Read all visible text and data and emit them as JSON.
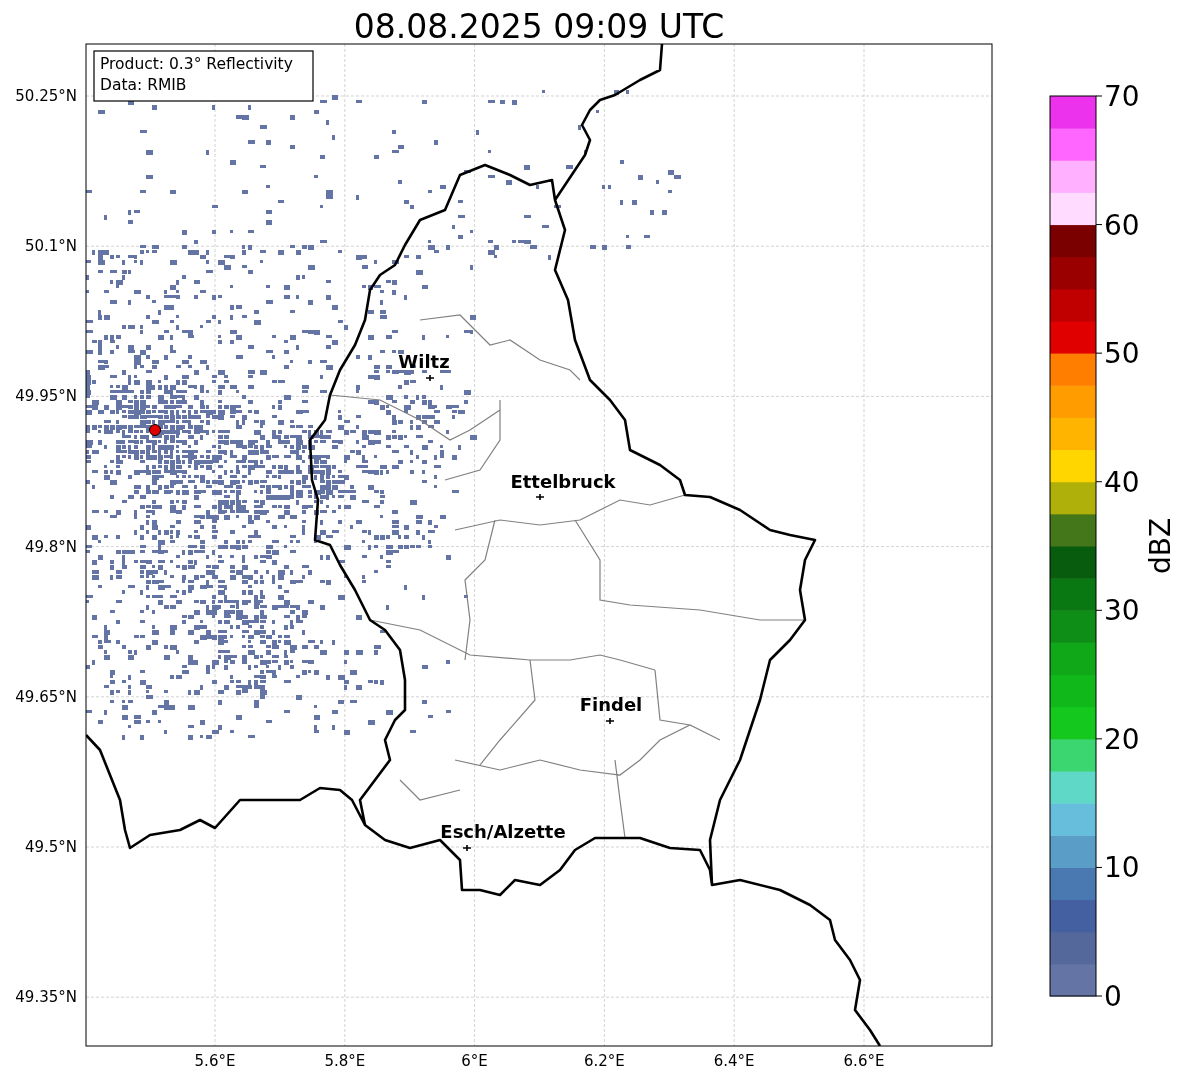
{
  "title": "08.08.2025 09:09 UTC",
  "info_box": [
    "Product: 0.3° Reflectivity",
    "Data: RMIB"
  ],
  "lat_ticks": [
    "50.25°N",
    "50.1°N",
    "49.95°N",
    "49.8°N",
    "49.65°N",
    "49.5°N",
    "49.35°N"
  ],
  "lon_ticks": [
    "5.6°E",
    "5.8°E",
    "6°E",
    "6.2°E",
    "6.4°E",
    "6.6°E"
  ],
  "cities": [
    {
      "name": "Wiltz"
    },
    {
      "name": "Ettelbruck"
    },
    {
      "name": "Findel"
    },
    {
      "name": "Esch/Alzette"
    }
  ],
  "colorbar": {
    "label": "dBZ",
    "ticks": [
      "70",
      "60",
      "50",
      "40",
      "30",
      "20",
      "10",
      "0"
    ],
    "segments": [
      {
        "color": "#6474a4"
      },
      {
        "color": "#54689c"
      },
      {
        "color": "#4460a0"
      },
      {
        "color": "#4a78b0"
      },
      {
        "color": "#5a9ec8"
      },
      {
        "color": "#66bedc"
      },
      {
        "color": "#60d8c8"
      },
      {
        "color": "#3cd670"
      },
      {
        "color": "#14c81e"
      },
      {
        "color": "#10b81a"
      },
      {
        "color": "#10a818"
      },
      {
        "color": "#0e8e16"
      },
      {
        "color": "#0a7812"
      },
      {
        "color": "#085c0e"
      },
      {
        "color": "#44761a"
      },
      {
        "color": "#b0b00a"
      },
      {
        "color": "#ffd600"
      },
      {
        "color": "#ffb400"
      },
      {
        "color": "#ff9c00"
      },
      {
        "color": "#ff7e00"
      },
      {
        "color": "#e00000"
      },
      {
        "color": "#c00000"
      },
      {
        "color": "#9a0000"
      },
      {
        "color": "#7a0000"
      },
      {
        "color": "#ffdcff"
      },
      {
        "color": "#ffb0ff"
      },
      {
        "color": "#ff66ff"
      },
      {
        "color": "#ec32ec"
      }
    ]
  }
}
